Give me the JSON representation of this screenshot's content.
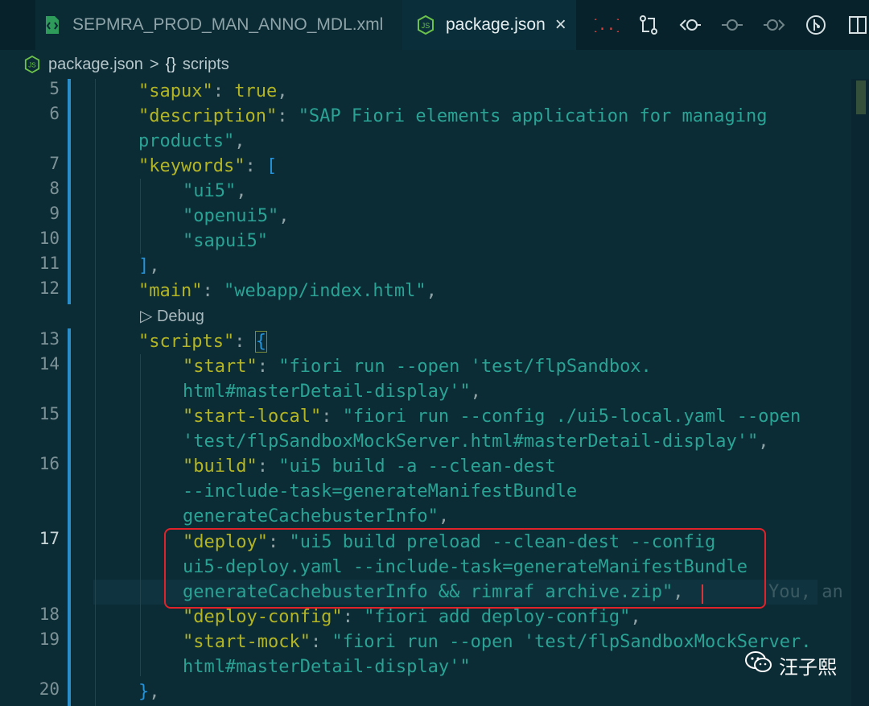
{
  "tabs": [
    {
      "label": "SEPMRA_PROD_MAN_ANNO_MDL.xml",
      "icon": "xml-file-icon",
      "active": false
    },
    {
      "label": "package.json",
      "icon": "nodejs-file-icon",
      "active": true,
      "close": "×"
    }
  ],
  "toolbar": [
    "json-braces-icon",
    "compare-changes-icon",
    "go-back-icon",
    "commit-dot-icon",
    "go-forward-icon",
    "git-graph-icon",
    "split-editor-icon"
  ],
  "breadcrumb": {
    "file": "package.json",
    "separator": ">",
    "brace": "{}",
    "symbol": "scripts"
  },
  "codelens": {
    "arrow": "▷",
    "label": "Debug"
  },
  "line_numbers": {
    "l5": "5",
    "l6": "6",
    "l7": "7",
    "l8": "8",
    "l9": "9",
    "l10": "10",
    "l11": "11",
    "l12": "12",
    "l13": "13",
    "l14": "14",
    "l15": "15",
    "l16": "16",
    "l17": "17",
    "l18": "18",
    "l19": "19",
    "l20": "20"
  },
  "code": {
    "l5": {
      "key": "\"sapux\"",
      "colon": ": ",
      "val": "true",
      "end": ","
    },
    "l6": {
      "key": "\"description\"",
      "colon": ": ",
      "val": "\"SAP Fiori elements application for managing",
      "cont": "products\"",
      "end": ","
    },
    "l7": {
      "key": "\"keywords\"",
      "colon": ": ",
      "open": "["
    },
    "l8": {
      "val": "\"ui5\"",
      "end": ","
    },
    "l9": {
      "val": "\"openui5\"",
      "end": ","
    },
    "l10": {
      "val": "\"sapui5\""
    },
    "l11": {
      "close": "]",
      "end": ","
    },
    "l12": {
      "key": "\"main\"",
      "colon": ": ",
      "val": "\"webapp/index.html\"",
      "end": ","
    },
    "l13": {
      "key": "\"scripts\"",
      "colon": ": ",
      "open": "{"
    },
    "l14": {
      "key": "\"start\"",
      "colon": ": ",
      "val": "\"fiori run --open 'test/flpSandbox.",
      "cont": "html#masterDetail-display'\"",
      "end": ","
    },
    "l15": {
      "key": "\"start-local\"",
      "colon": ": ",
      "val": "\"fiori run --config ./ui5-local.yaml --open",
      "cont": "'test/flpSandboxMockServer.html#masterDetail-display'\"",
      "end": ","
    },
    "l16": {
      "key": "\"build\"",
      "colon": ": ",
      "val": "\"ui5 build -a --clean-dest",
      "cont": "--include-task=generateManifestBundle",
      "cont2": "generateCachebusterInfo\"",
      "end": ","
    },
    "l17": {
      "key": "\"deploy\"",
      "colon": ": ",
      "val": "\"ui5 build preload --clean-dest --config",
      "cont": "ui5-deploy.yaml --include-task=generateManifestBundle",
      "cont2": "generateCachebusterInfo && rimraf archive.zip\"",
      "end": ",",
      "ghost": "You, an"
    },
    "l18": {
      "key": "\"deploy-config\"",
      "colon": ": ",
      "val": "\"fiori add deploy-config\"",
      "end": ","
    },
    "l19": {
      "key": "\"start-mock\"",
      "colon": ": ",
      "val": "\"fiori run --open 'test/flpSandboxMockServer.",
      "cont": "html#masterDetail-display'\""
    },
    "l20": {
      "close": "}",
      "end": ","
    }
  },
  "watermark": {
    "icon": "wechat-icon",
    "text": "汪子熙"
  },
  "colors": {
    "key": "#b3b524",
    "string": "#2aa395",
    "bracket": "#2693d8",
    "highlight_border": "#e0232a",
    "background": "#0b2b35"
  }
}
